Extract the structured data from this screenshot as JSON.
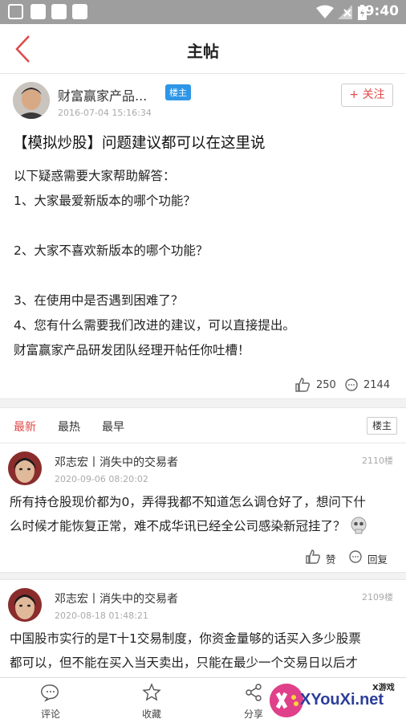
{
  "status_bar": {
    "time": "9:40"
  },
  "nav": {
    "title": "主帖"
  },
  "post": {
    "author": "财富赢家产品...",
    "badge": "楼主",
    "date": "2016-07-04 15:16:34",
    "follow_label": "+ 关注",
    "title": "【模拟炒股】问题建议都可以在这里说",
    "body_lines": [
      "以下疑惑需要大家帮助解答：",
      "1、大家最爱新版本的哪个功能？",
      "",
      "2、大家不喜欢新版本的哪个功能？",
      "",
      "3、在使用中是否遇到困难了？",
      "4、您有什么需要我们改进的建议，可以直接提出。",
      "财富赢家产品研发团队经理开帖任你吐槽！"
    ],
    "likes": "250",
    "comments": "2144"
  },
  "sort_tabs": [
    "最新",
    "最热",
    "最早"
  ],
  "owner_filter": "楼主",
  "comments": [
    {
      "name": "邓志宏丨消失中的交易者",
      "date": "2020-09-06 08:20:02",
      "floor": "2110楼",
      "lines": [
        "所有持仓股现价都为0，弄得我都不知道怎么调仓好了，想问下什",
        "么时候才能恢复正常，难不成华讯已经全公司感染新冠挂了？"
      ],
      "like_label": "赞",
      "reply_label": "回复"
    },
    {
      "name": "邓志宏丨消失中的交易者",
      "date": "2020-08-18 01:48:21",
      "floor": "2109楼",
      "lines": [
        "中国股市实行的是T十1交易制度，你资金量够的话买入多少股票",
        "都可以，但不能在买入当天卖出，只能在最少一个交易日以后才"
      ]
    }
  ],
  "bottom_bar": [
    {
      "label": "评论",
      "icon": "comment-icon"
    },
    {
      "label": "收藏",
      "icon": "star-icon"
    },
    {
      "label": "分享",
      "icon": "share-icon"
    }
  ],
  "watermark": {
    "text": "XYouXi.net",
    "tag": "X游戏"
  },
  "colors": {
    "accent": "#e04a4a",
    "badge": "#2d96e6",
    "statusbar": "#9e9e9e"
  }
}
